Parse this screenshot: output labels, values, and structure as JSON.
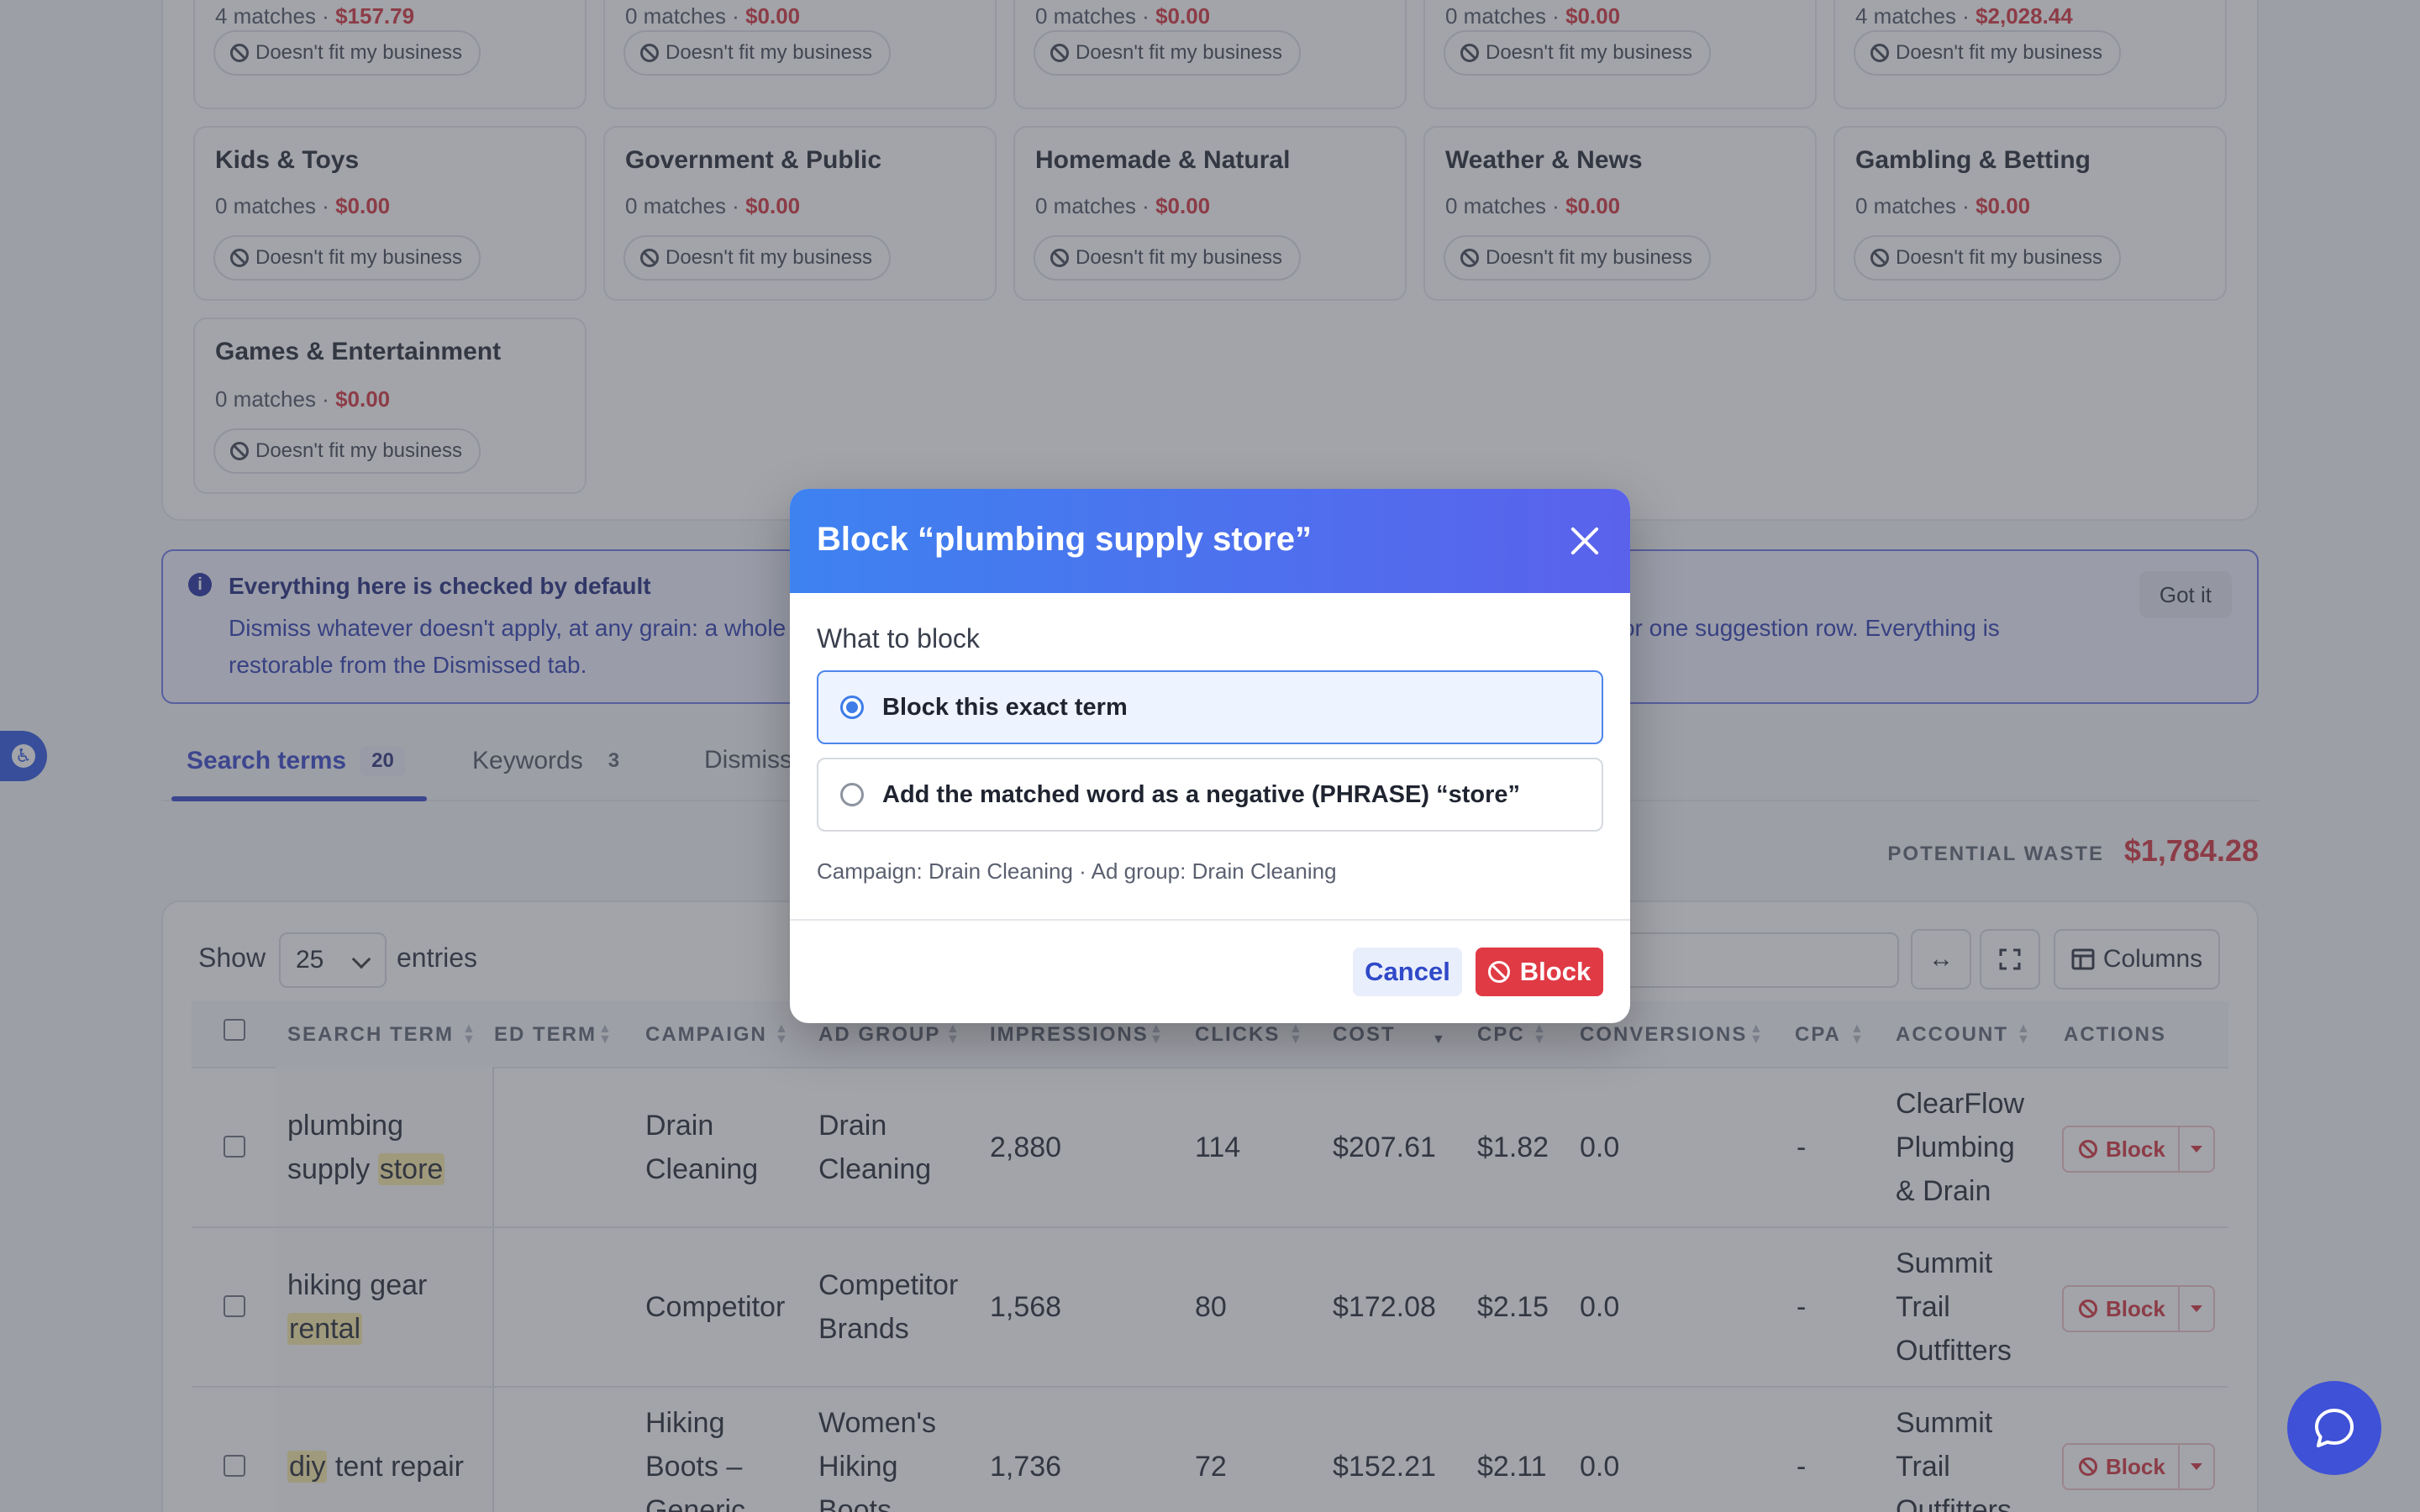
{
  "categories": [
    {
      "name": "",
      "matches": "4 matches",
      "cost": "$157.79",
      "action": "Doesn't fit my business"
    },
    {
      "name": "",
      "matches": "0 matches",
      "cost": "$0.00",
      "action": "Doesn't fit my business"
    },
    {
      "name": "",
      "matches": "0 matches",
      "cost": "$0.00",
      "action": "Doesn't fit my business"
    },
    {
      "name": "",
      "matches": "0 matches",
      "cost": "$0.00",
      "action": "Doesn't fit my business"
    },
    {
      "name": "",
      "matches": "4 matches",
      "cost": "$2,028.44",
      "action": "Doesn't fit my business"
    },
    {
      "name": "Kids & Toys",
      "matches": "0 matches",
      "cost": "$0.00",
      "action": "Doesn't fit my business"
    },
    {
      "name": "Government & Public",
      "matches": "0 matches",
      "cost": "$0.00",
      "action": "Doesn't fit my business"
    },
    {
      "name": "Homemade & Natural",
      "matches": "0 matches",
      "cost": "$0.00",
      "action": "Doesn't fit my business"
    },
    {
      "name": "Weather & News",
      "matches": "0 matches",
      "cost": "$0.00",
      "action": "Doesn't fit my business"
    },
    {
      "name": "Gambling & Betting",
      "matches": "0 matches",
      "cost": "$0.00",
      "action": "Doesn't fit my business"
    },
    {
      "name": "Games & Entertainment",
      "matches": "0 matches",
      "cost": "$0.00",
      "action": "Doesn't fit my business"
    }
  ],
  "info_banner": {
    "title": "Everything here is checked by default",
    "body_start": "Dismiss whatever doesn't apply, at any grain: a whole",
    "body_end": "\"), or one suggestion row. Everything is",
    "body_line2": "restorable from the Dismissed tab.",
    "got_it": "Got it"
  },
  "tabs": [
    {
      "label": "Search terms",
      "count": "20"
    },
    {
      "label": "Keywords",
      "count": "3"
    },
    {
      "label": "Dismiss",
      "count": ""
    }
  ],
  "potential_waste": {
    "label": "POTENTIAL WASTE",
    "value": "$1,784.28"
  },
  "table_controls": {
    "show": "Show",
    "entries_value": "25",
    "entries": "entries",
    "columns": "Columns"
  },
  "table": {
    "headers": [
      "SEARCH TERM",
      "ED TERM",
      "CAMPAIGN",
      "AD GROUP",
      "IMPRESSIONS",
      "CLICKS",
      "COST",
      "CPC",
      "CONVERSIONS",
      "CPA",
      "ACCOUNT",
      "ACTIONS"
    ],
    "rows": [
      {
        "term_a": "plumbing",
        "term_b": "supply ",
        "term_hl": "store",
        "campaign_1": "Drain",
        "campaign_2": "Cleaning",
        "campaign_3": "",
        "adgroup_1": "Drain",
        "adgroup_2": "Cleaning",
        "adgroup_3": "",
        "impressions": "2,880",
        "clicks": "114",
        "cost": "$207.61",
        "cpc": "$1.82",
        "conversions": "0.0",
        "cpa": "-",
        "account_1": "ClearFlow",
        "account_2": "Plumbing",
        "account_3": "& Drain",
        "action": "Block"
      },
      {
        "term_a": "hiking gear",
        "term_b": "",
        "term_hl": "rental",
        "campaign_1": "Competitor",
        "campaign_2": "",
        "campaign_3": "",
        "adgroup_1": "Competitor",
        "adgroup_2": "Brands",
        "adgroup_3": "",
        "impressions": "1,568",
        "clicks": "80",
        "cost": "$172.08",
        "cpc": "$2.15",
        "conversions": "0.0",
        "cpa": "-",
        "account_1": "Summit",
        "account_2": "Trail",
        "account_3": "Outfitters",
        "action": "Block"
      },
      {
        "term_hl": "diy",
        "term_rest": " tent repair",
        "campaign_1": "Hiking",
        "campaign_2": "Boots –",
        "campaign_3": "Generic",
        "adgroup_1": "Women's",
        "adgroup_2": "Hiking",
        "adgroup_3": "Boots",
        "impressions": "1,736",
        "clicks": "72",
        "cost": "$152.21",
        "cpc": "$2.11",
        "conversions": "0.0",
        "cpa": "-",
        "account_1": "Summit",
        "account_2": "Trail",
        "account_3": "Outfitters",
        "action": "Block"
      }
    ]
  },
  "modal": {
    "title": "Block “plumbing supply store”",
    "what_label": "What to block",
    "option_exact": "Block this exact term",
    "option_phrase": "Add the matched word as a negative (PHRASE) “store”",
    "context": "Campaign: Drain Cleaning · Ad group: Drain Cleaning",
    "cancel": "Cancel",
    "block": "Block"
  },
  "colors": {
    "accent": "#3442c9",
    "danger": "#d32f3a",
    "modal_header_start": "#3e82f0",
    "modal_header_end": "#5a62ec"
  }
}
